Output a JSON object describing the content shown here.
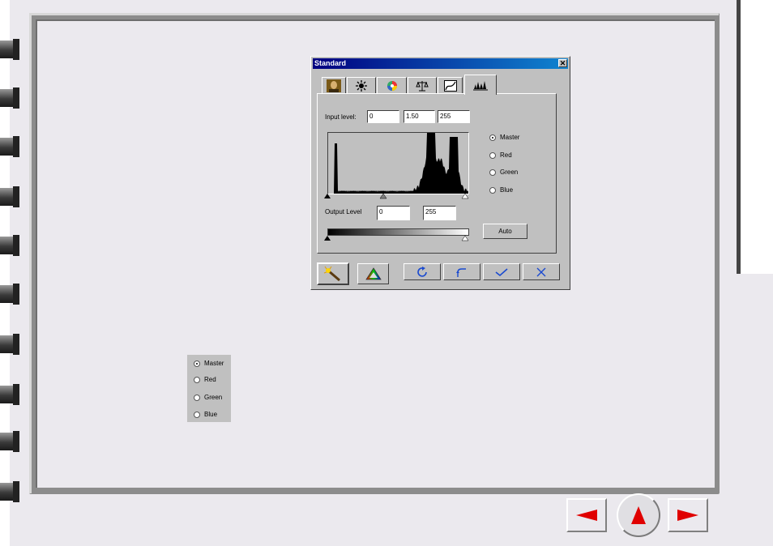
{
  "dialog": {
    "title": "Standard",
    "close_label": "✕",
    "tabs": [
      {
        "icon": "portrait-icon"
      },
      {
        "icon": "brightness-icon"
      },
      {
        "icon": "color-wheel-icon"
      },
      {
        "icon": "balance-icon"
      },
      {
        "icon": "curve-icon"
      },
      {
        "icon": "levels-icon"
      }
    ],
    "input_level_label": "Input level:",
    "input_level_values": [
      "0",
      "1.50",
      "255"
    ],
    "output_level_label": "Output Level",
    "output_level_values": [
      "0",
      "255"
    ],
    "channels": [
      "Master",
      "Red",
      "Green",
      "Blue"
    ],
    "selected_channel": "Master",
    "auto_label": "Auto",
    "bottom_buttons": [
      "magic-wand-icon",
      "triangle-color-icon",
      "reset-icon",
      "undo-icon",
      "ok-check-icon",
      "cancel-x-icon"
    ]
  },
  "standalone_channels": [
    "Master",
    "Red",
    "Green",
    "Blue"
  ],
  "standalone_selected": "Master",
  "nav": {
    "prev_icon": "left-arrow-icon",
    "home_icon": "up-arrow-icon",
    "next_icon": "right-arrow-icon",
    "arrow_color": "#e00000"
  },
  "histogram_icon_color": "#000000"
}
